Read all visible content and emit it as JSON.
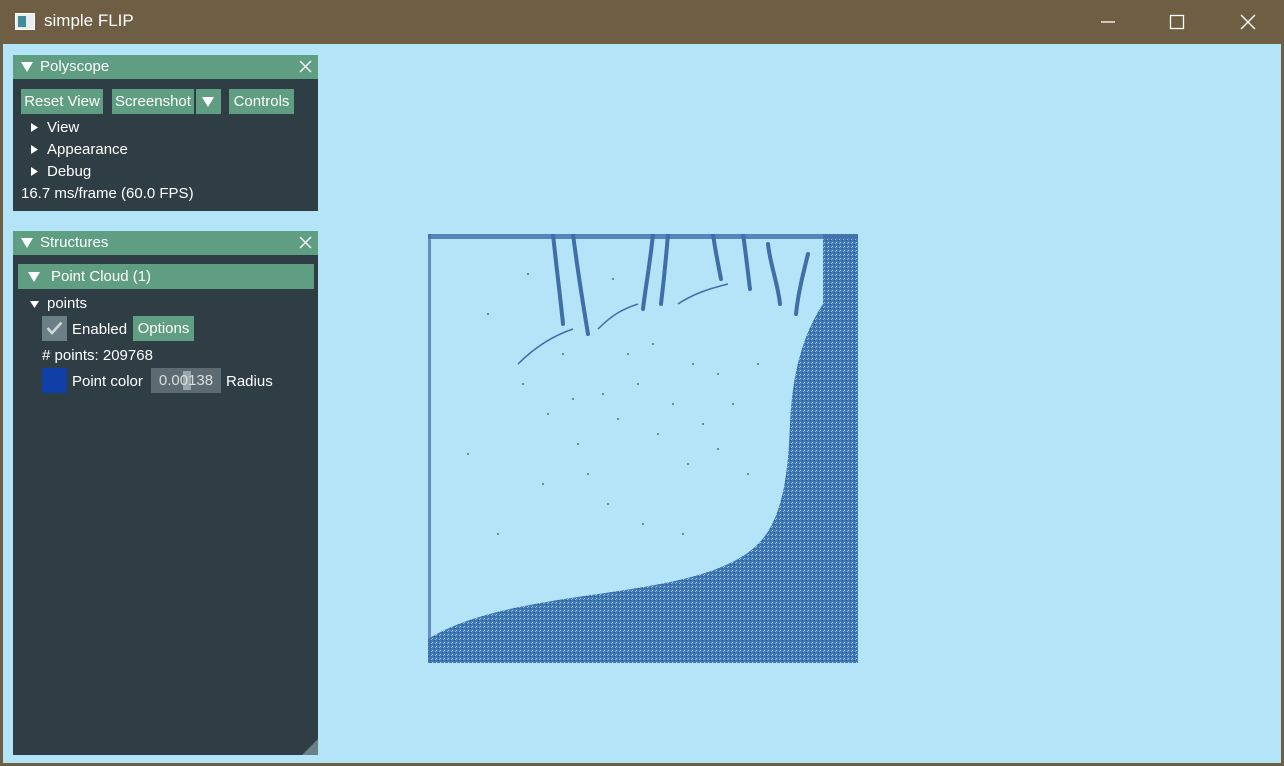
{
  "window": {
    "title": "simple FLIP",
    "icons": [
      "app-icon",
      "minimize-icon",
      "maximize-icon",
      "close-icon"
    ]
  },
  "polyscope": {
    "title": "Polyscope",
    "buttons": {
      "reset_view": "Reset View",
      "screenshot": "Screenshot",
      "controls": "Controls"
    },
    "sections": [
      "View",
      "Appearance",
      "Debug"
    ],
    "fps": "16.7 ms/frame (60.0 FPS)"
  },
  "structures": {
    "title": "Structures",
    "group": "Point Cloud (1)",
    "item": "points",
    "enabled_label": "Enabled",
    "enabled": true,
    "options_label": "Options",
    "points_count": "# points: 209768",
    "point_color_label": "Point color",
    "point_color": "#0f3fa6",
    "radius_value": "0.00138",
    "radius_label": "Radius"
  },
  "colors": {
    "panel_bg": "#2f3d44",
    "accent": "#5f9e83",
    "viewport_bg": "#b4e4f8",
    "titlebar": "#6e5e44",
    "fluid": "#3f78b4"
  }
}
